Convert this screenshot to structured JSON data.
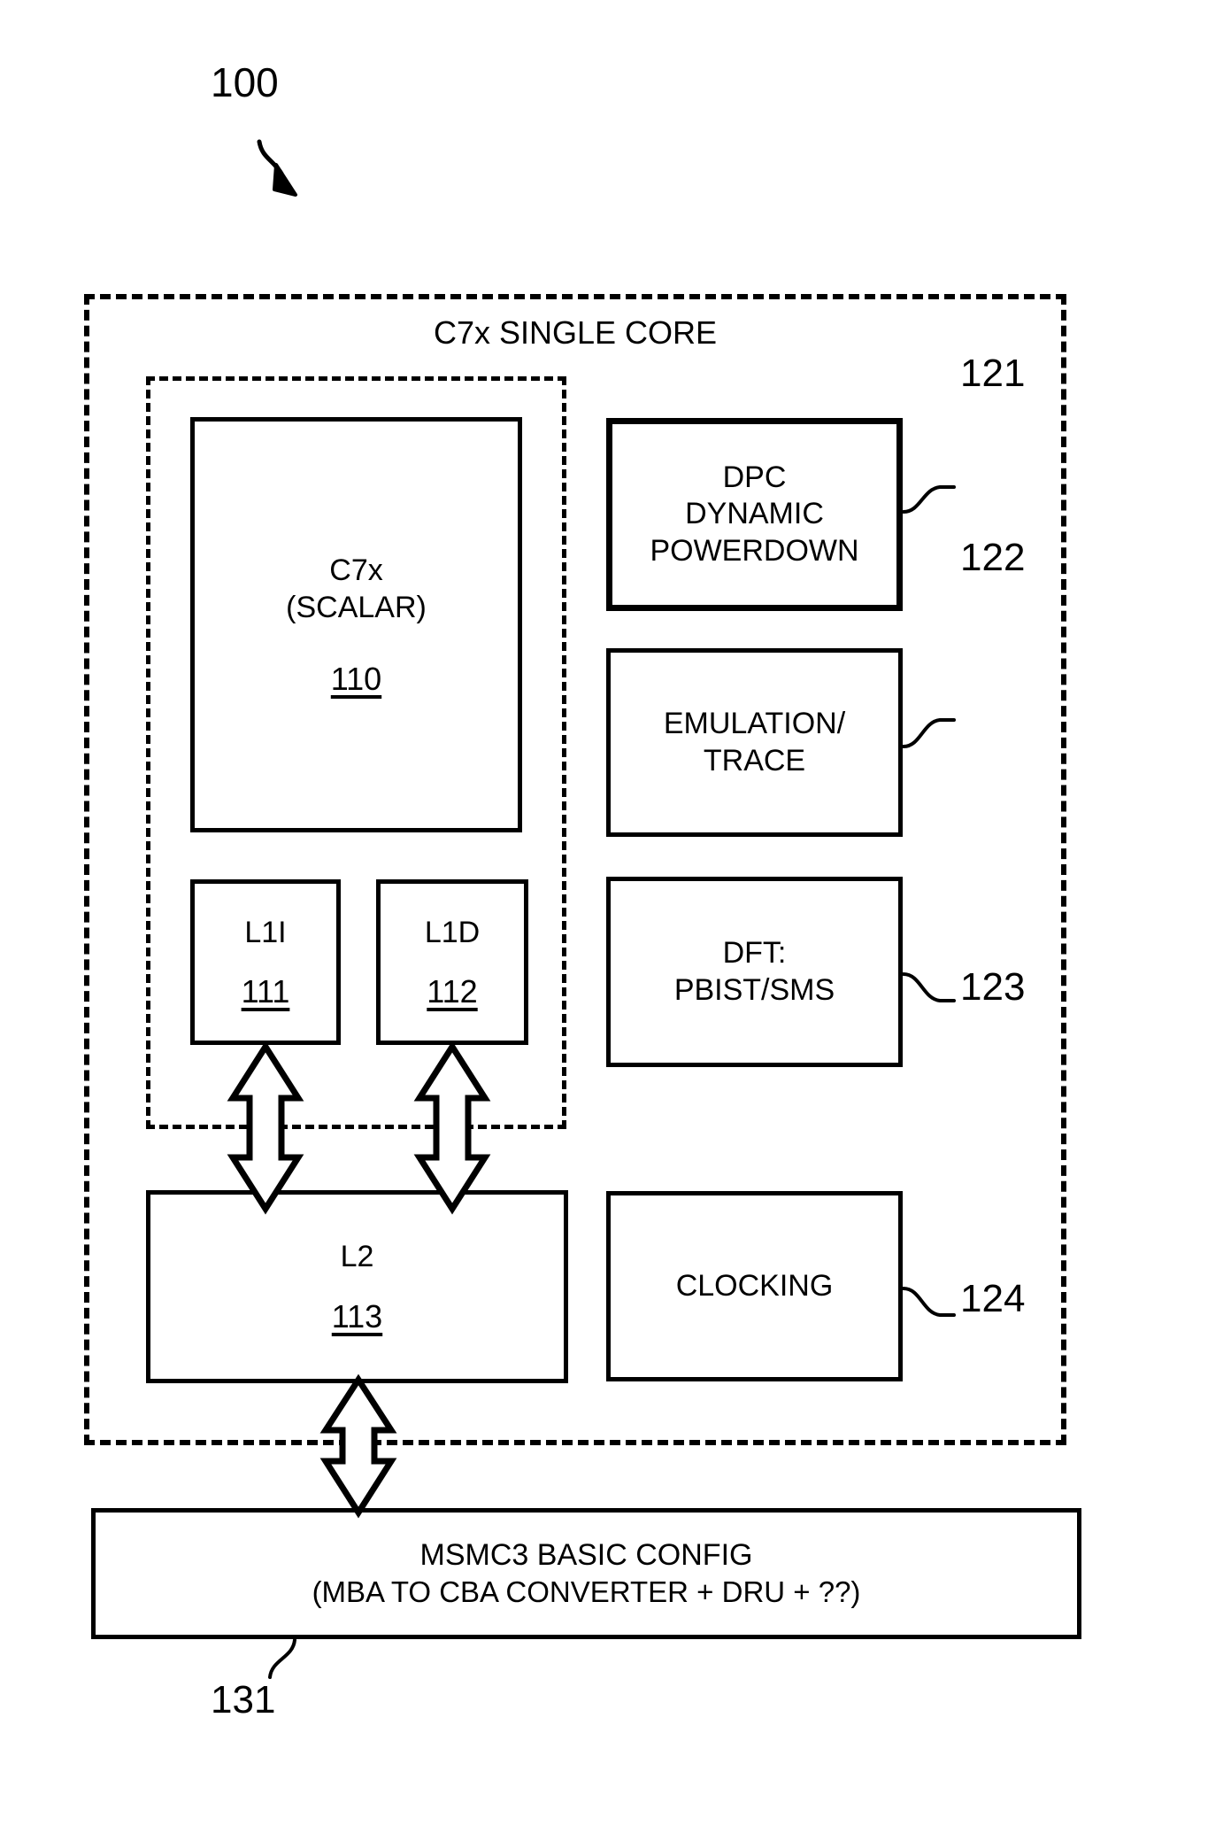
{
  "figure": {
    "number": "100",
    "title": "C7x SINGLE CORE"
  },
  "core": {
    "label": "C7x SINGLE CORE",
    "cpu": {
      "line1": "C7x",
      "line2": "(SCALAR)",
      "ref": "110"
    },
    "caches": [
      {
        "name": "L1I",
        "ref": "111"
      },
      {
        "name": "L1D",
        "ref": "112"
      }
    ],
    "l2": {
      "name": "L2",
      "ref": "113"
    }
  },
  "support_blocks": [
    {
      "lines": [
        "DPC",
        "DYNAMIC",
        "POWERDOWN"
      ],
      "ref": "121"
    },
    {
      "lines": [
        "EMULATION/",
        "TRACE"
      ],
      "ref": "122"
    },
    {
      "lines": [
        "DFT:",
        "PBIST/SMS"
      ],
      "ref": "123"
    },
    {
      "lines": [
        "CLOCKING"
      ],
      "ref": "124"
    }
  ],
  "memory_controller": {
    "line1": "MSMC3 BASIC CONFIG",
    "line2": "(MBA TO CBA CONVERTER + DRU + ??)",
    "ref": "131"
  }
}
